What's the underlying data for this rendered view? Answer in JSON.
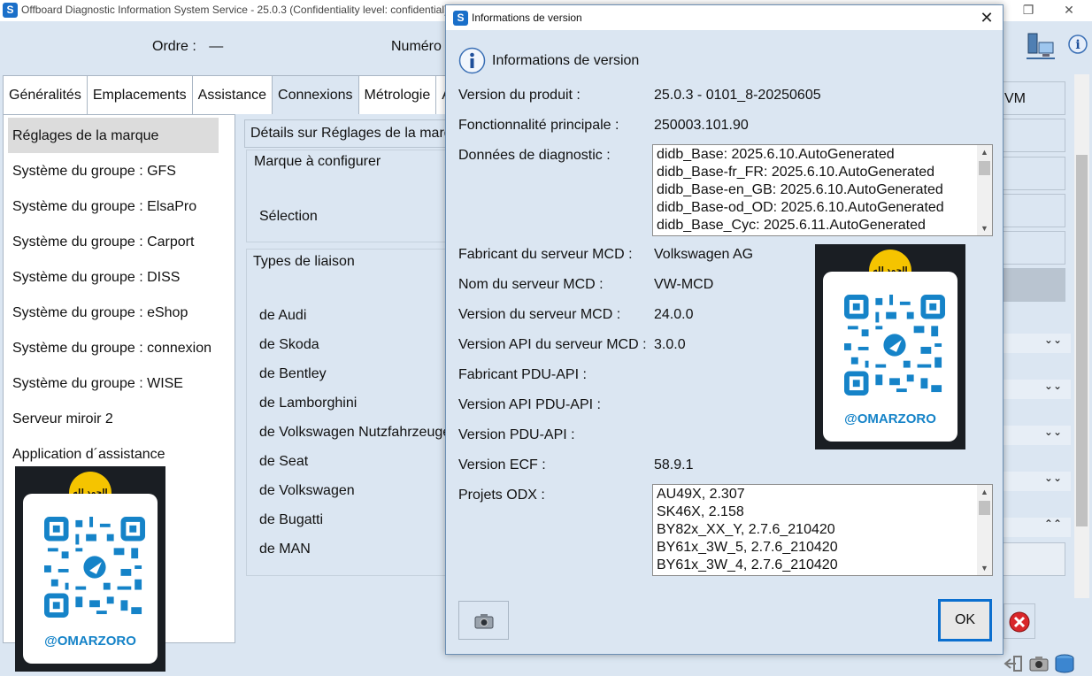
{
  "main_window": {
    "title": "Offboard Diagnostic Information System Service - 25.0.3 (Confidentiality level: confidential)",
    "order_label": "Ordre :",
    "order_value": "—",
    "number_label": "Numéro d"
  },
  "tabs": [
    {
      "label": "Généralités"
    },
    {
      "label": "Emplacements"
    },
    {
      "label": "Assistance"
    },
    {
      "label": "Connexions"
    },
    {
      "label": "Métrologie"
    },
    {
      "label": "A"
    }
  ],
  "left_menu": [
    {
      "label": "Réglages de la marque"
    },
    {
      "label": "Système du groupe : GFS"
    },
    {
      "label": "Système du groupe : ElsaPro"
    },
    {
      "label": "Système du groupe : Carport"
    },
    {
      "label": "Système du groupe : DISS"
    },
    {
      "label": "Système du groupe : eShop"
    },
    {
      "label": "Système du groupe : connexion"
    },
    {
      "label": "Système du groupe : WISE"
    },
    {
      "label": "Serveur miroir 2"
    },
    {
      "label": "Application d´assistance"
    }
  ],
  "middle": {
    "header": "Détails sur Réglages de la marque",
    "brand_group": "Marque à configurer",
    "selection_label": "Sélection",
    "link_group": "Types de liaison",
    "brands": [
      {
        "label": "de Audi"
      },
      {
        "label": "de Skoda"
      },
      {
        "label": "de Bentley"
      },
      {
        "label": "de Lamborghini"
      },
      {
        "label": "de Volkswagen Nutzfahrzeuge"
      },
      {
        "label": "de Seat"
      },
      {
        "label": "de Volkswagen"
      },
      {
        "label": "de Bugatti"
      },
      {
        "label": "de MAN"
      }
    ]
  },
  "right": {
    "vm_label": "VM"
  },
  "overlay": {
    "badge_text": "الحمد لله",
    "badge_sub": "Alhamdulillah",
    "handle": "@OMARZORO"
  },
  "dialog": {
    "title": "Informations de version",
    "heading": "Informations de version",
    "fields": {
      "product_version_label": "Version du produit :",
      "product_version_value": "25.0.3  -  0101_8-20250605",
      "main_feature_label": "Fonctionnalité principale :",
      "main_feature_value": "250003.101.90",
      "diag_data_label": "Données de diagnostic :",
      "mcd_maker_label": "Fabricant du serveur MCD :",
      "mcd_maker_value": "Volkswagen AG",
      "mcd_name_label": "Nom du serveur MCD :",
      "mcd_name_value": "VW-MCD",
      "mcd_version_label": "Version du serveur MCD :",
      "mcd_version_value": "24.0.0",
      "mcd_api_label": "Version API du serveur MCD :",
      "mcd_api_value": "3.0.0",
      "pdu_maker_label": "Fabricant PDU-API :",
      "pdu_api_label": "Version API PDU-API :",
      "pdu_version_label": "Version PDU-API :",
      "ecf_label": "Version ECF :",
      "ecf_value": "58.9.1",
      "odx_label": "Projets ODX :"
    },
    "diag_data_list": [
      "didb_Base: 2025.6.10.AutoGenerated",
      "didb_Base-fr_FR: 2025.6.10.AutoGenerated",
      "didb_Base-en_GB: 2025.6.10.AutoGenerated",
      "didb_Base-od_OD: 2025.6.10.AutoGenerated",
      "didb_Base_Cyc: 2025.6.11.AutoGenerated"
    ],
    "odx_list": [
      "AU49X, 2.307",
      "SK46X, 2.158",
      "BY82x_XX_Y, 2.7.6_210420",
      "BY61x_3W_5, 2.7.6_210420",
      "BY61x_3W_4, 2.7.6_210420"
    ],
    "ok_label": "OK"
  }
}
